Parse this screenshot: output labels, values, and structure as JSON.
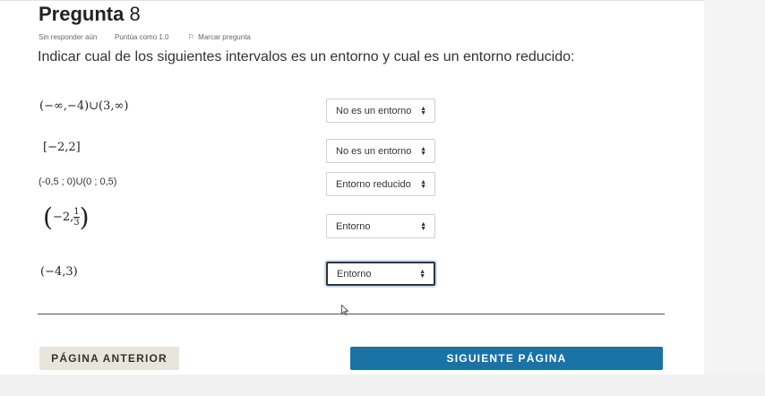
{
  "question": {
    "word": "Pregunta",
    "number": "8",
    "status": "Sin responder aún",
    "score": "Puntúa como 1.0",
    "flag_label": "Marcar pregunta",
    "prompt": "Indicar cual de los siguientes intervalos es un entorno y cual es un entorno reducido:"
  },
  "rows": [
    {
      "label": "(−∞,−4)∪(3,∞)",
      "select": "No es un entorno"
    },
    {
      "label": "[−2,2]",
      "select": "No es un entorno"
    },
    {
      "label": "(-0,5 ; 0)U(0 ; 0,5)",
      "select": "Entorno reducido"
    },
    {
      "label_prefix": "−2,",
      "frac_num": "1",
      "frac_den": "3",
      "select": "Entorno"
    },
    {
      "label": "(−4,3)",
      "select": "Entorno"
    }
  ],
  "nav": {
    "prev_label": "PÁGINA ANTERIOR",
    "next_label": "SIGUIENTE PÁGINA"
  },
  "icons": {
    "flag": "flag-icon",
    "select_arrows": "sort-arrows-icon",
    "cursor": "mouse-cursor-icon"
  },
  "colors": {
    "next_button": "#1a72a5",
    "prev_button": "#e8e6dc"
  }
}
